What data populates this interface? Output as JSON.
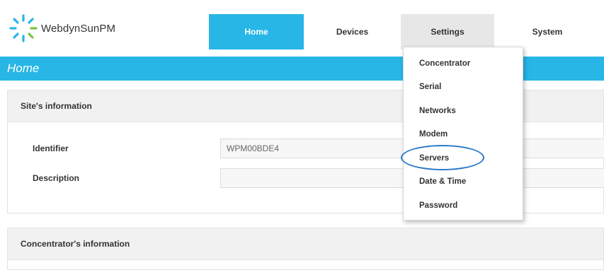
{
  "brand": {
    "name": "WebdynSunPM",
    "logo_icon": "sunburst-logo-icon",
    "accent": "#27b6e6"
  },
  "nav": {
    "tabs": [
      {
        "label": "Home",
        "active": true
      },
      {
        "label": "Devices",
        "active": false
      },
      {
        "label": "Settings",
        "active": false,
        "open": true
      },
      {
        "label": "System",
        "active": false
      }
    ]
  },
  "page": {
    "title": "Home"
  },
  "site_panel": {
    "header": "Site's information",
    "fields": [
      {
        "label": "Identifier",
        "value": "WPM00BDE4"
      },
      {
        "label": "Description",
        "value": ""
      }
    ]
  },
  "concentrator_panel": {
    "header": "Concentrator's information"
  },
  "settings_menu": {
    "items": [
      "Concentrator",
      "Serial",
      "Networks",
      "Modem",
      "Servers",
      "Date & Time",
      "Password"
    ],
    "highlighted": "Servers",
    "highlight_color": "#2a79c8"
  }
}
